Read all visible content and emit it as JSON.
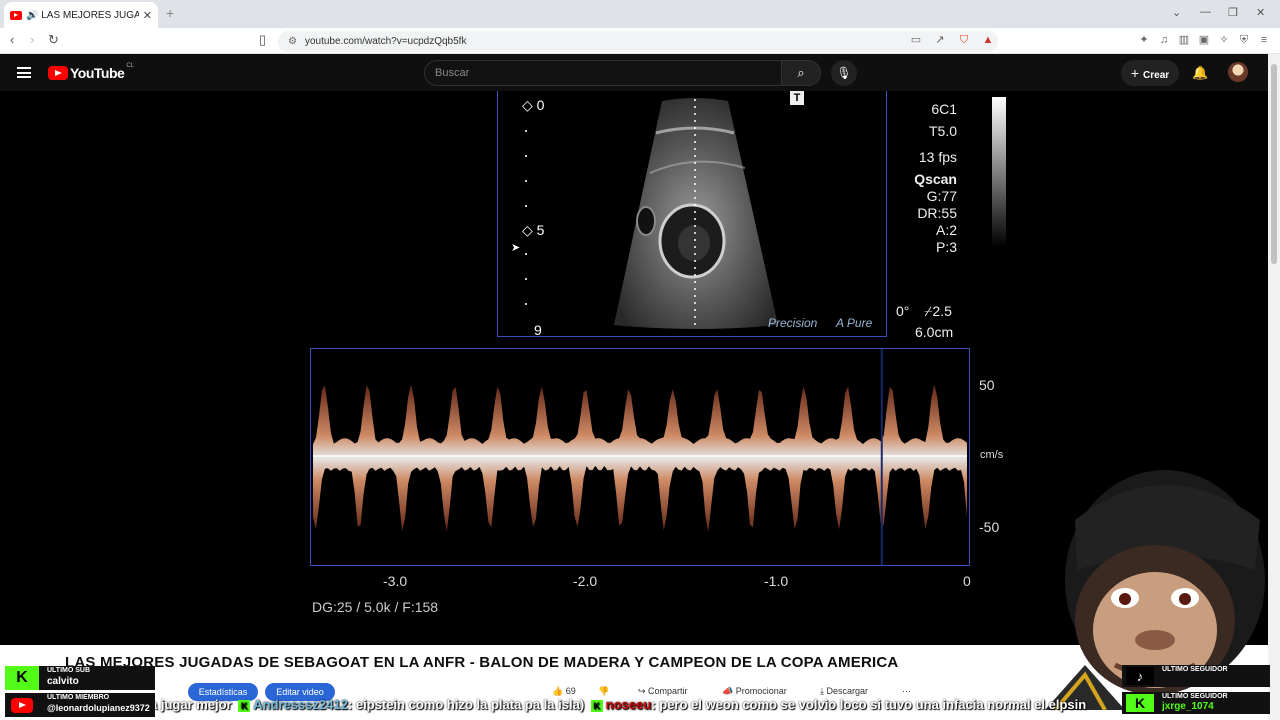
{
  "browser": {
    "tab_title": "🔊 LAS MEJORES JUGADA",
    "tab_close": "✕",
    "new_tab": "+",
    "url": "youtube.com/watch?v=ucpdzQqb5fk"
  },
  "youtube": {
    "logo_text": "YouTube",
    "country": "CL",
    "search_placeholder": "Buscar",
    "create_label": "Crear"
  },
  "ultrasound": {
    "depth_labels": [
      "0",
      "5",
      "9"
    ],
    "info": [
      "6C1",
      "T5.0",
      "13 fps",
      "Qscan",
      "G:77",
      "DR:55",
      "A:2",
      "P:3"
    ],
    "angle": "0°",
    "focus": "2.5",
    "depth_cm": "6.0cm",
    "brand_precision": "Precision",
    "brand_pure": "A Pure",
    "marker": "T",
    "velocity_ticks": [
      "50",
      "cm/s",
      "-50"
    ],
    "time_ticks": [
      "-3.0",
      "-2.0",
      "-1.0",
      "0"
    ],
    "settings": "DG:25   / 5.0k    / F:158"
  },
  "video_title": "LAS MEJORES JUGADAS DE SEBAGOAT EN LA ANFR - BALON DE MADERA Y CAMPEON DE LA COPA AMERICA",
  "actions": {
    "stats": "Estadísticas",
    "edit": "Editar video",
    "likes": "69",
    "share": "Compartir",
    "promote": "Promocionar",
    "download": "Descargar",
    "more": "···"
  },
  "ticker": {
    "part1": "a jugar mejor",
    "user1": "Andresssz2412",
    "msg1": ": eipstein como hizo la plata pa la isla)",
    "user2": "noseeu",
    "msg2": ": pero el weon como se volvio loco si tuvo una infacia normal el elpsin"
  },
  "alerts": {
    "sub_label": "ULTIMO SUB",
    "sub_value": "calvito",
    "member_label": "ULTIMO MIEMBRO",
    "member_value": "@leonardolupianez9372",
    "follower1_label": "ULTIMO SEGUIDOR",
    "follower2_label": "ULTIMO SEGUIDOR",
    "follower2_value": "jxrge_1074"
  },
  "colors": {
    "yt_red": "#ff0000",
    "kick_green": "#53fc18",
    "pill_blue": "#2a66d6",
    "frame_blue": "#3c4fb8"
  }
}
